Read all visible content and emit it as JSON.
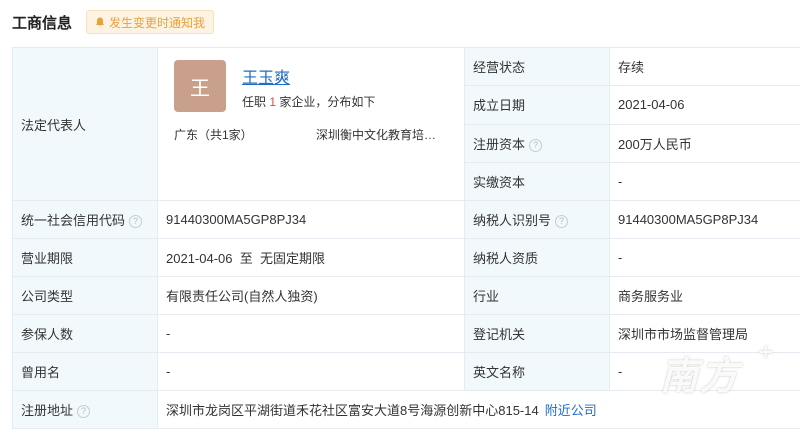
{
  "header": {
    "title": "工商信息",
    "notify_label": "发生变更时通知我"
  },
  "rep": {
    "label": "法定代表人",
    "avatar_char": "王",
    "name": "王玉爽",
    "desc_pre": "任职",
    "desc_num": "1",
    "desc_post": "家企业，分布如下",
    "region": "广东（共1家）",
    "company": "深圳衡中文化教育培…"
  },
  "rows": {
    "status_label": "经营状态",
    "status_value": "存续",
    "founded_label": "成立日期",
    "founded_value": "2021-04-06",
    "capital_label": "注册资本",
    "capital_value": "200万人民币",
    "paid_label": "实缴资本",
    "paid_value": "-",
    "credit_label": "统一社会信用代码",
    "credit_value": "91440300MA5GP8PJ34",
    "taxid_label": "纳税人识别号",
    "taxid_value": "91440300MA5GP8PJ34",
    "term_label": "营业期限",
    "term_value": "2021-04-06  至  无固定期限",
    "taxqual_label": "纳税人资质",
    "taxqual_value": "-",
    "type_label": "公司类型",
    "type_value": "有限责任公司(自然人独资)",
    "industry_label": "行业",
    "industry_value": "商务服务业",
    "insured_label": "参保人数",
    "insured_value": "-",
    "authority_label": "登记机关",
    "authority_value": "深圳市市场监督管理局",
    "former_label": "曾用名",
    "former_value": "-",
    "english_label": "英文名称",
    "english_value": "-",
    "address_label": "注册地址",
    "address_value": "深圳市龙岗区平湖街道禾花社区富安大道8号海源创新中心815-14",
    "nearby_label": "附近公司"
  },
  "watermark": {
    "text": "南方",
    "plus": "+"
  },
  "help_glyph": "?"
}
